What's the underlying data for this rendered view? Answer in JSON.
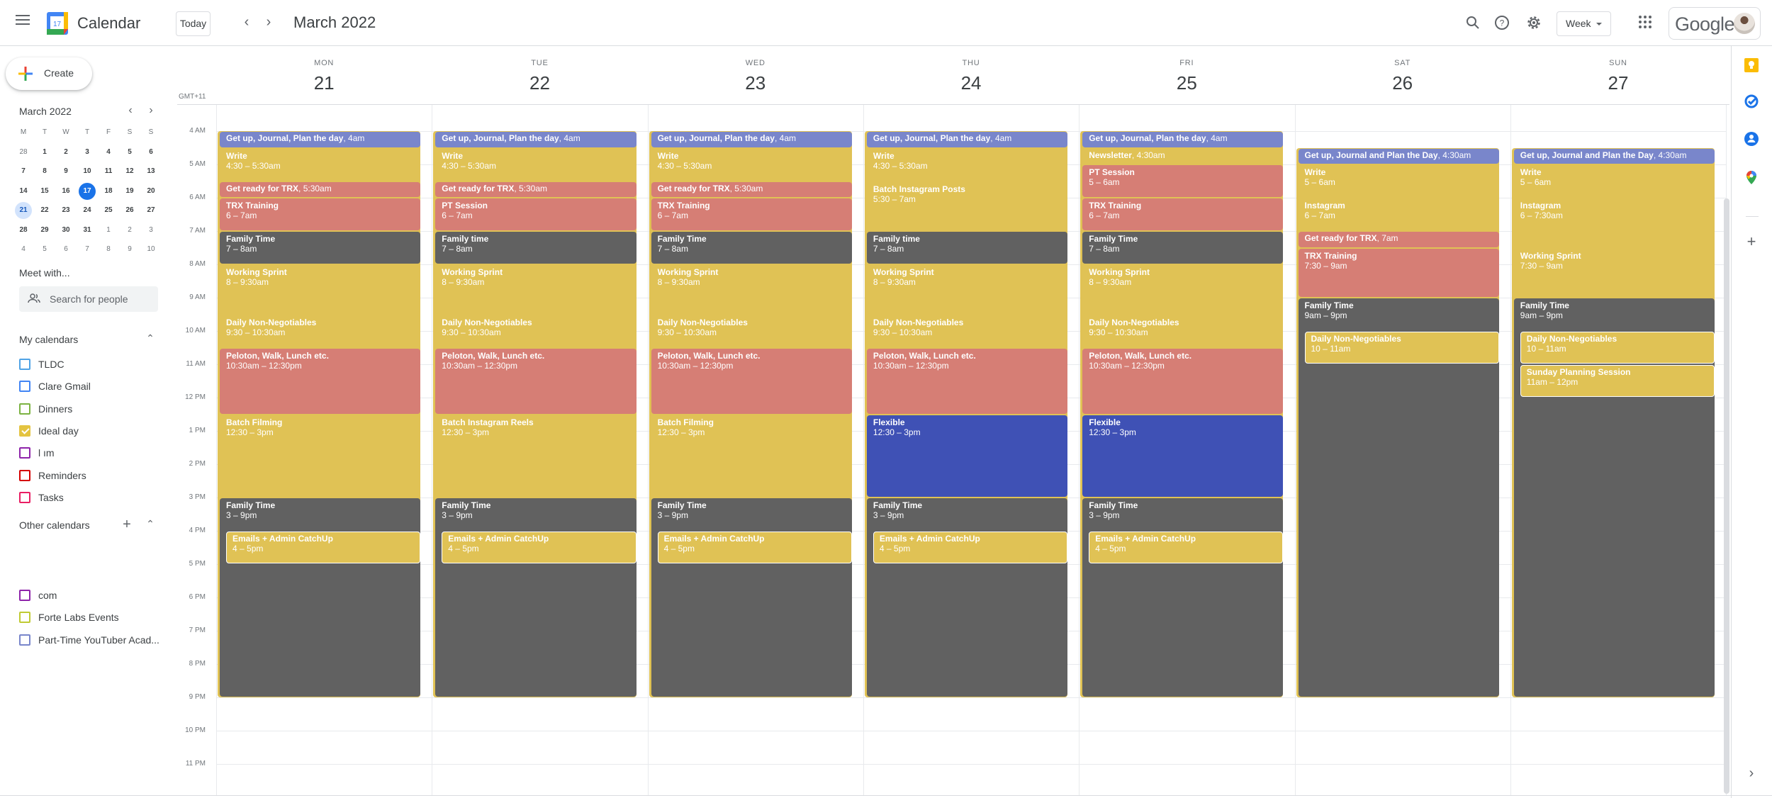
{
  "app": {
    "title": "Calendar",
    "logo_day": "17",
    "period_title": "March 2022",
    "today_label": "Today",
    "prev_label": "‹",
    "next_label": "›",
    "view_select": "Week",
    "account_brand": "Google",
    "icons": [
      "menu-icon",
      "search-icon",
      "help-icon",
      "settings-icon",
      "apps-icon",
      "account-avatar"
    ]
  },
  "sidebar": {
    "create_label": "Create",
    "mini_calendar": {
      "title": "March 2022",
      "weekday_headers": [
        "M",
        "T",
        "W",
        "T",
        "F",
        "S",
        "S"
      ],
      "weeks": [
        [
          {
            "d": "28",
            "other": true
          },
          {
            "d": "1"
          },
          {
            "d": "2"
          },
          {
            "d": "3"
          },
          {
            "d": "4"
          },
          {
            "d": "5"
          },
          {
            "d": "6"
          }
        ],
        [
          {
            "d": "7"
          },
          {
            "d": "8"
          },
          {
            "d": "9"
          },
          {
            "d": "10"
          },
          {
            "d": "11"
          },
          {
            "d": "12"
          },
          {
            "d": "13"
          }
        ],
        [
          {
            "d": "14"
          },
          {
            "d": "15"
          },
          {
            "d": "16"
          },
          {
            "d": "17",
            "today": true
          },
          {
            "d": "18"
          },
          {
            "d": "19"
          },
          {
            "d": "20"
          }
        ],
        [
          {
            "d": "21",
            "selected": true
          },
          {
            "d": "22"
          },
          {
            "d": "23"
          },
          {
            "d": "24"
          },
          {
            "d": "25"
          },
          {
            "d": "26"
          },
          {
            "d": "27"
          }
        ],
        [
          {
            "d": "28"
          },
          {
            "d": "29"
          },
          {
            "d": "30"
          },
          {
            "d": "31"
          },
          {
            "d": "1",
            "other": true
          },
          {
            "d": "2",
            "other": true
          },
          {
            "d": "3",
            "other": true
          }
        ],
        [
          {
            "d": "4",
            "other": true
          },
          {
            "d": "5",
            "other": true
          },
          {
            "d": "6",
            "other": true
          },
          {
            "d": "7",
            "other": true
          },
          {
            "d": "8",
            "other": true
          },
          {
            "d": "9",
            "other": true
          },
          {
            "d": "10",
            "other": true
          }
        ]
      ]
    },
    "meet_with": {
      "title": "Meet with...",
      "search_placeholder": "Search for people"
    },
    "my_calendars": {
      "title": "My calendars",
      "items": [
        {
          "label": "TLDC",
          "color": "#4fa3e6",
          "checked": false
        },
        {
          "label": "Clare Gmail",
          "color": "#4285f4",
          "checked": false
        },
        {
          "label": "Dinners",
          "color": "#7cb342",
          "checked": false
        },
        {
          "label": "Ideal day",
          "color": "#e4c441",
          "checked": true
        },
        {
          "label": "l                    ım",
          "color": "#8e24aa",
          "checked": false
        },
        {
          "label": "Reminders",
          "color": "#d50000",
          "checked": false
        },
        {
          "label": "Tasks",
          "color": "#e91e63",
          "checked": false
        }
      ]
    },
    "other_calendars": {
      "title": "Other calendars",
      "items": [
        {
          "label": "                          com",
          "color": "#8e24aa",
          "checked": false
        },
        {
          "label": "Forte Labs Events",
          "color": "#c0ca33",
          "checked": false
        },
        {
          "label": "Part-Time YouTuber Acad...",
          "color": "#7986cb",
          "checked": false
        }
      ]
    }
  },
  "week": {
    "timezone_label": "GMT+11",
    "hour_labels": [
      "4 AM",
      "5 AM",
      "6 AM",
      "7 AM",
      "8 AM",
      "9 AM",
      "10 AM",
      "11 AM",
      "12 PM",
      "1 PM",
      "2 PM",
      "3 PM",
      "4 PM",
      "5 PM",
      "6 PM",
      "7 PM",
      "8 PM",
      "9 PM",
      "10 PM",
      "11 PM"
    ],
    "colors": {
      "lavender": "#7986cb",
      "banana": "#e0c255",
      "flamingo": "#d67e75",
      "graphite": "#616161",
      "blueberry": "#3f51b5"
    },
    "days": [
      {
        "dow": "MON",
        "dom": "21",
        "events": [
          {
            "title": "Get up, Journal, Plan the day",
            "time": "4am",
            "start": 4,
            "end": 4.5,
            "color": "lavender",
            "short": true
          },
          {
            "title": "Write",
            "time": "4:30 – 5:30am",
            "start": 4.5,
            "end": 5.5,
            "color": "banana"
          },
          {
            "title": "Get ready for TRX",
            "time": "5:30am",
            "start": 5.5,
            "end": 6,
            "color": "flamingo",
            "short": true
          },
          {
            "title": "TRX Training",
            "time": "6 – 7am",
            "start": 6,
            "end": 7,
            "color": "flamingo"
          },
          {
            "title": "Family Time",
            "time": "7 – 8am",
            "start": 7,
            "end": 8,
            "color": "graphite"
          },
          {
            "title": "Working Sprint",
            "time": "8 – 9:30am",
            "start": 8,
            "end": 9.5,
            "color": "banana"
          },
          {
            "title": "Daily Non-Negotiables",
            "time": "9:30 – 10:30am",
            "start": 9.5,
            "end": 10.5,
            "color": "banana"
          },
          {
            "title": "Peloton, Walk, Lunch etc.",
            "time": "10:30am – 12:30pm",
            "start": 10.5,
            "end": 12.5,
            "color": "flamingo"
          },
          {
            "title": "Batch Filming",
            "time": "12:30 – 3pm",
            "start": 12.5,
            "end": 15,
            "color": "banana"
          },
          {
            "title": "Family Time",
            "time": "3 – 9pm",
            "start": 15,
            "end": 21,
            "color": "graphite"
          },
          {
            "title": "Emails + Admin CatchUp",
            "time": "4 – 5pm",
            "start": 16,
            "end": 17,
            "color": "banana",
            "nested": true
          }
        ]
      },
      {
        "dow": "TUE",
        "dom": "22",
        "events": [
          {
            "title": "Get up, Journal, Plan the day",
            "time": "4am",
            "start": 4,
            "end": 4.5,
            "color": "lavender",
            "short": true
          },
          {
            "title": "Write",
            "time": "4:30 – 5:30am",
            "start": 4.5,
            "end": 5.5,
            "color": "banana"
          },
          {
            "title": "Get ready for TRX",
            "time": "5:30am",
            "start": 5.5,
            "end": 6,
            "color": "flamingo",
            "short": true
          },
          {
            "title": "PT Session",
            "time": "6 – 7am",
            "start": 6,
            "end": 7,
            "color": "flamingo"
          },
          {
            "title": "Family time",
            "time": "7 – 8am",
            "start": 7,
            "end": 8,
            "color": "graphite"
          },
          {
            "title": "Working Sprint",
            "time": "8 – 9:30am",
            "start": 8,
            "end": 9.5,
            "color": "banana"
          },
          {
            "title": "Daily Non-Negotiables",
            "time": "9:30 – 10:30am",
            "start": 9.5,
            "end": 10.5,
            "color": "banana"
          },
          {
            "title": "Peloton, Walk, Lunch etc.",
            "time": "10:30am – 12:30pm",
            "start": 10.5,
            "end": 12.5,
            "color": "flamingo"
          },
          {
            "title": "Batch Instagram Reels",
            "time": "12:30 – 3pm",
            "start": 12.5,
            "end": 15,
            "color": "banana"
          },
          {
            "title": "Family Time",
            "time": "3 – 9pm",
            "start": 15,
            "end": 21,
            "color": "graphite"
          },
          {
            "title": "Emails + Admin CatchUp",
            "time": "4 – 5pm",
            "start": 16,
            "end": 17,
            "color": "banana",
            "nested": true
          }
        ]
      },
      {
        "dow": "WED",
        "dom": "23",
        "events": [
          {
            "title": "Get up, Journal, Plan the day",
            "time": "4am",
            "start": 4,
            "end": 4.5,
            "color": "lavender",
            "short": true
          },
          {
            "title": "Write",
            "time": "4:30 – 5:30am",
            "start": 4.5,
            "end": 5.5,
            "color": "banana"
          },
          {
            "title": "Get ready for TRX",
            "time": "5:30am",
            "start": 5.5,
            "end": 6,
            "color": "flamingo",
            "short": true
          },
          {
            "title": "TRX Training",
            "time": "6 – 7am",
            "start": 6,
            "end": 7,
            "color": "flamingo"
          },
          {
            "title": "Family Time",
            "time": "7 – 8am",
            "start": 7,
            "end": 8,
            "color": "graphite"
          },
          {
            "title": "Working Sprint",
            "time": "8 – 9:30am",
            "start": 8,
            "end": 9.5,
            "color": "banana"
          },
          {
            "title": "Daily Non-Negotiables",
            "time": "9:30 – 10:30am",
            "start": 9.5,
            "end": 10.5,
            "color": "banana"
          },
          {
            "title": "Peloton, Walk, Lunch etc.",
            "time": "10:30am – 12:30pm",
            "start": 10.5,
            "end": 12.5,
            "color": "flamingo"
          },
          {
            "title": "Batch Filming",
            "time": "12:30 – 3pm",
            "start": 12.5,
            "end": 15,
            "color": "banana"
          },
          {
            "title": "Family Time",
            "time": "3 – 9pm",
            "start": 15,
            "end": 21,
            "color": "graphite"
          },
          {
            "title": "Emails + Admin CatchUp",
            "time": "4 – 5pm",
            "start": 16,
            "end": 17,
            "color": "banana",
            "nested": true
          }
        ]
      },
      {
        "dow": "THU",
        "dom": "24",
        "events": [
          {
            "title": "Get up, Journal, Plan the day",
            "time": "4am",
            "start": 4,
            "end": 4.5,
            "color": "lavender",
            "short": true
          },
          {
            "title": "Write",
            "time": "4:30 – 5:30am",
            "start": 4.5,
            "end": 5.5,
            "color": "banana"
          },
          {
            "title": "Batch Instagram Posts",
            "time": "5:30 – 7am",
            "start": 5.5,
            "end": 7,
            "color": "banana"
          },
          {
            "title": "Family time",
            "time": "7 – 8am",
            "start": 7,
            "end": 8,
            "color": "graphite"
          },
          {
            "title": "Working Sprint",
            "time": "8 – 9:30am",
            "start": 8,
            "end": 9.5,
            "color": "banana"
          },
          {
            "title": "Daily Non-Negotiables",
            "time": "9:30 – 10:30am",
            "start": 9.5,
            "end": 10.5,
            "color": "banana"
          },
          {
            "title": "Peloton, Walk, Lunch etc.",
            "time": "10:30am – 12:30pm",
            "start": 10.5,
            "end": 12.5,
            "color": "flamingo"
          },
          {
            "title": "Flexible",
            "time": "12:30 – 3pm",
            "start": 12.5,
            "end": 15,
            "color": "blueberry"
          },
          {
            "title": "Family Time",
            "time": "3 – 9pm",
            "start": 15,
            "end": 21,
            "color": "graphite"
          },
          {
            "title": "Emails + Admin CatchUp",
            "time": "4 – 5pm",
            "start": 16,
            "end": 17,
            "color": "banana",
            "nested": true
          }
        ]
      },
      {
        "dow": "FRI",
        "dom": "25",
        "events": [
          {
            "title": "Get up, Journal, Plan the day",
            "time": "4am",
            "start": 4,
            "end": 4.5,
            "color": "lavender",
            "short": true
          },
          {
            "title": "Newsletter",
            "time": "4:30am",
            "start": 4.5,
            "end": 5,
            "color": "banana",
            "short": true
          },
          {
            "title": "PT Session",
            "time": "5 – 6am",
            "start": 5,
            "end": 6,
            "color": "flamingo"
          },
          {
            "title": "TRX Training",
            "time": "6 – 7am",
            "start": 6,
            "end": 7,
            "color": "flamingo"
          },
          {
            "title": "Family Time",
            "time": "7 – 8am",
            "start": 7,
            "end": 8,
            "color": "graphite"
          },
          {
            "title": "Working Sprint",
            "time": "8 – 9:30am",
            "start": 8,
            "end": 9.5,
            "color": "banana"
          },
          {
            "title": "Daily Non-Negotiables",
            "time": "9:30 – 10:30am",
            "start": 9.5,
            "end": 10.5,
            "color": "banana"
          },
          {
            "title": "Peloton, Walk, Lunch etc.",
            "time": "10:30am – 12:30pm",
            "start": 10.5,
            "end": 12.5,
            "color": "flamingo"
          },
          {
            "title": "Flexible",
            "time": "12:30 – 3pm",
            "start": 12.5,
            "end": 15,
            "color": "blueberry"
          },
          {
            "title": "Family Time",
            "time": "3 – 9pm",
            "start": 15,
            "end": 21,
            "color": "graphite"
          },
          {
            "title": "Emails + Admin CatchUp",
            "time": "4 – 5pm",
            "start": 16,
            "end": 17,
            "color": "banana",
            "nested": true
          }
        ]
      },
      {
        "dow": "SAT",
        "dom": "26",
        "events": [
          {
            "title": "Get up, Journal and Plan the Day",
            "time": "4:30am",
            "start": 4.5,
            "end": 5,
            "color": "lavender",
            "short": true
          },
          {
            "title": "Write",
            "time": "5 – 6am",
            "start": 5,
            "end": 6,
            "color": "banana"
          },
          {
            "title": "Instagram",
            "time": "6 – 7am",
            "start": 6,
            "end": 7,
            "color": "banana"
          },
          {
            "title": "Get ready for TRX",
            "time": "7am",
            "start": 7,
            "end": 7.5,
            "color": "flamingo",
            "short": true
          },
          {
            "title": "TRX Training",
            "time": "7:30 – 9am",
            "start": 7.5,
            "end": 9,
            "color": "flamingo"
          },
          {
            "title": "Family Time",
            "time": "9am – 9pm",
            "start": 9,
            "end": 21,
            "color": "graphite"
          },
          {
            "title": "Daily Non-Negotiables",
            "time": "10 – 11am",
            "start": 10,
            "end": 11,
            "color": "banana",
            "nested": true
          }
        ]
      },
      {
        "dow": "SUN",
        "dom": "27",
        "events": [
          {
            "title": "Get up, Journal and Plan the Day",
            "time": "4:30am",
            "start": 4.5,
            "end": 5,
            "color": "lavender",
            "short": true
          },
          {
            "title": "Write",
            "time": "5 – 6am",
            "start": 5,
            "end": 6,
            "color": "banana"
          },
          {
            "title": "Instagram",
            "time": "6 – 7:30am",
            "start": 6,
            "end": 7.5,
            "color": "banana"
          },
          {
            "title": "Working Sprint",
            "time": "7:30 – 9am",
            "start": 7.5,
            "end": 9,
            "color": "banana"
          },
          {
            "title": "Family Time",
            "time": "9am – 9pm",
            "start": 9,
            "end": 21,
            "color": "graphite"
          },
          {
            "title": "Daily Non-Negotiables",
            "time": "10 – 11am",
            "start": 10,
            "end": 11,
            "color": "banana",
            "nested": true
          },
          {
            "title": "Sunday Planning Session",
            "time": "11am – 12pm",
            "start": 11,
            "end": 12,
            "color": "banana",
            "nested": true
          }
        ]
      }
    ]
  },
  "right_panel": {
    "icons": [
      "keep-icon",
      "tasks-icon",
      "contacts-icon",
      "maps-icon",
      "add-addon-icon",
      "expand-panel-icon"
    ]
  }
}
